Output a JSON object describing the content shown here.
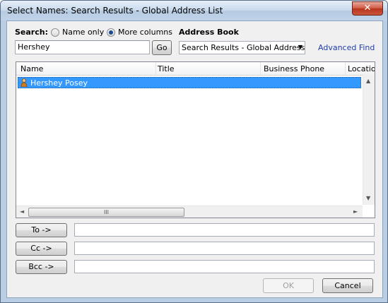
{
  "window": {
    "title": "Select Names: Search Results - Global Address List",
    "close_glyph": "✕"
  },
  "search": {
    "label": "Search:",
    "option_name_only": "Name only",
    "option_more_columns": "More columns",
    "selected_option": "More columns",
    "query_value": "Hershey",
    "go_label": "Go"
  },
  "address_book": {
    "label": "Address Book",
    "selected": "Search Results - Global Address L",
    "advanced_find": "Advanced Find"
  },
  "results": {
    "columns": [
      "Name",
      "Title",
      "Business Phone",
      "Location"
    ],
    "rows": [
      {
        "name": "Hershey Posey",
        "selected": true
      }
    ]
  },
  "scrollbar": {
    "grip": "III",
    "left_arrow": "◄",
    "right_arrow": "►",
    "up_arrow": "▲",
    "down_arrow": "▼"
  },
  "recipients": {
    "to_label": "To ->",
    "cc_label": "Cc ->",
    "bcc_label": "Bcc ->",
    "to_value": "",
    "cc_value": "",
    "bcc_value": ""
  },
  "footer": {
    "ok_label": "OK",
    "cancel_label": "Cancel"
  }
}
